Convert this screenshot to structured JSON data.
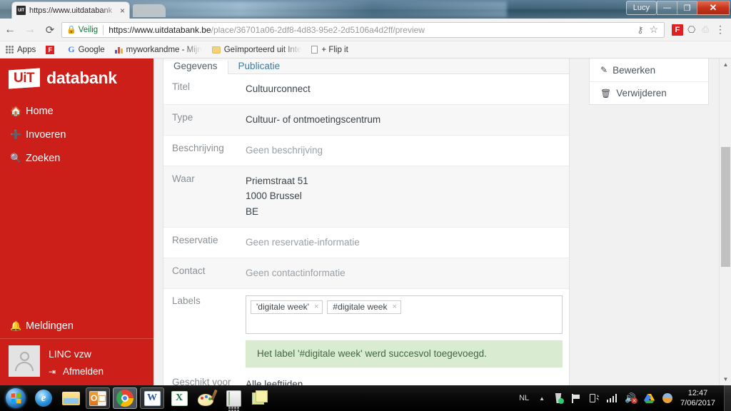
{
  "browser": {
    "tab": {
      "title": "https://www.uitdatabank",
      "favicon_label": "UiT",
      "close_label": "×"
    },
    "window": {
      "user_button": "Lucy",
      "minimize": "—",
      "maximize": "❐",
      "close": "✕"
    },
    "nav": {
      "back": "←",
      "forward": "→",
      "reload": "⟳",
      "secure_label": "Veilig",
      "lock_icon": "🔒",
      "url_domain": "https://www.uitdatabank.be",
      "url_path": "/place/36701a06-2df8-4d83-95e2-2d5106a4d2ff/preview",
      "key_icon": "⚷",
      "star_icon": "☆",
      "flipboard_ext": "F",
      "cast_icon": "⎔",
      "pdf_icon": "⎙",
      "menu_icon": "⋮"
    },
    "bookmarks": [
      {
        "label": "Apps",
        "icon": "apps-grid-icon"
      },
      {
        "label": "",
        "icon": "flipboard-icon"
      },
      {
        "label": "Google",
        "icon": "google-g-icon"
      },
      {
        "label": "myworkandme - Mijn",
        "icon": "bars-icon"
      },
      {
        "label": "Geïmporteerd uit Inte",
        "icon": "folder-icon"
      },
      {
        "label": "+ Flip it",
        "icon": "page-icon"
      }
    ]
  },
  "sidebar": {
    "brand_mark": "UiT",
    "brand_text": "databank",
    "items": [
      {
        "label": "Home",
        "icon": "home-icon",
        "glyph": "⌂"
      },
      {
        "label": "Invoeren",
        "icon": "plus-circle-icon",
        "glyph": "⊕"
      },
      {
        "label": "Zoeken",
        "icon": "search-icon",
        "glyph": "⌕"
      }
    ],
    "notifications": {
      "label": "Meldingen",
      "icon": "bell-icon",
      "glyph": "🔔"
    },
    "user": {
      "name": "LINC vzw",
      "logout_label": "Afmelden",
      "logout_glyph": "⇥"
    }
  },
  "content": {
    "tabs": [
      {
        "label": "Gegevens",
        "active": true
      },
      {
        "label": "Publicatie",
        "active": false
      }
    ],
    "rows": [
      {
        "label": "Titel",
        "value": "Cultuurconnect",
        "muted": false
      },
      {
        "label": "Type",
        "value": "Cultuur- of ontmoetingscentrum",
        "muted": false
      },
      {
        "label": "Beschrijving",
        "value": "Geen beschrijving",
        "muted": true
      },
      {
        "label": "Waar",
        "value": "Priemstraat 51\n1000 Brussel\nBE",
        "muted": false
      },
      {
        "label": "Reservatie",
        "value": "Geen reservatie-informatie",
        "muted": true
      },
      {
        "label": "Contact",
        "value": "Geen contactinformatie",
        "muted": true
      }
    ],
    "labels_section": {
      "label": "Labels",
      "chips": [
        {
          "text": "'digitale week'",
          "remove": "×"
        },
        {
          "text": "#digitale week",
          "remove": "×"
        }
      ],
      "alert": "Het label '#digitale week' werd succesvol toegevoegd.",
      "alert_bg": "#d9ecd2",
      "alert_color": "#41683a"
    },
    "last_row": {
      "label": "Geschikt voor",
      "value": "Alle leeftijden"
    }
  },
  "right_panel": {
    "items": [
      {
        "label": "Bewerken",
        "icon": "pencil-icon",
        "glyph": "✎"
      },
      {
        "label": "Verwijderen",
        "icon": "trash-icon",
        "glyph": "🗑"
      }
    ]
  },
  "scrollbar": {
    "up": "▲",
    "down": "▼"
  },
  "taskbar": {
    "start": {
      "label": "start-orb"
    },
    "apps": [
      {
        "name": "internet-explorer",
        "state": "pinned"
      },
      {
        "name": "file-explorer",
        "state": "pinned"
      },
      {
        "name": "outlook",
        "state": "open"
      },
      {
        "name": "google-chrome",
        "state": "active"
      },
      {
        "name": "word",
        "state": "open"
      },
      {
        "name": "excel",
        "state": "pinned"
      },
      {
        "name": "paint",
        "state": "pinned"
      },
      {
        "name": "calculator",
        "state": "pinned"
      },
      {
        "name": "sticky-notes",
        "state": "pinned"
      }
    ],
    "tray": {
      "language": "NL",
      "show_hidden": "▲",
      "icons": [
        "recycle-icon",
        "flag-icon",
        "battery-icon",
        "network-icon",
        "volume-muted-icon",
        "drive-icon",
        "picture-icon"
      ],
      "time": "12:47",
      "date": "7/06/2017"
    }
  },
  "colors": {
    "brand_red": "#cc1f1a",
    "success_green": "#d9ecd2",
    "link_blue": "#3a7ca5",
    "chrome_gray": "#f2f2f2"
  }
}
